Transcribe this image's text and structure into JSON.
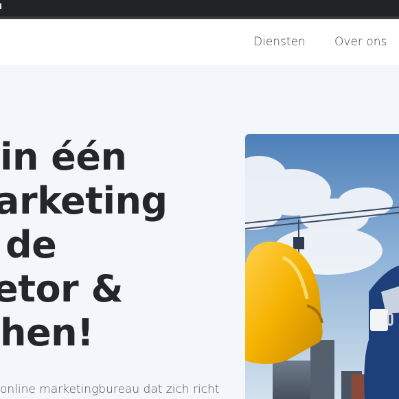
{
  "navbar": {
    "links": [
      {
        "label": "Diensten"
      },
      {
        "label": "Over ons"
      }
    ]
  },
  "hero": {
    "heading_lines": [
      "in één",
      "arketing",
      "de",
      "etor &",
      "hen!"
    ],
    "subtext": "online marketingbureau dat zich richt"
  },
  "colors": {
    "topbar": "#202226",
    "background": "#f3f6fb",
    "heading": "#24262b",
    "helmet": "#f5b100"
  }
}
